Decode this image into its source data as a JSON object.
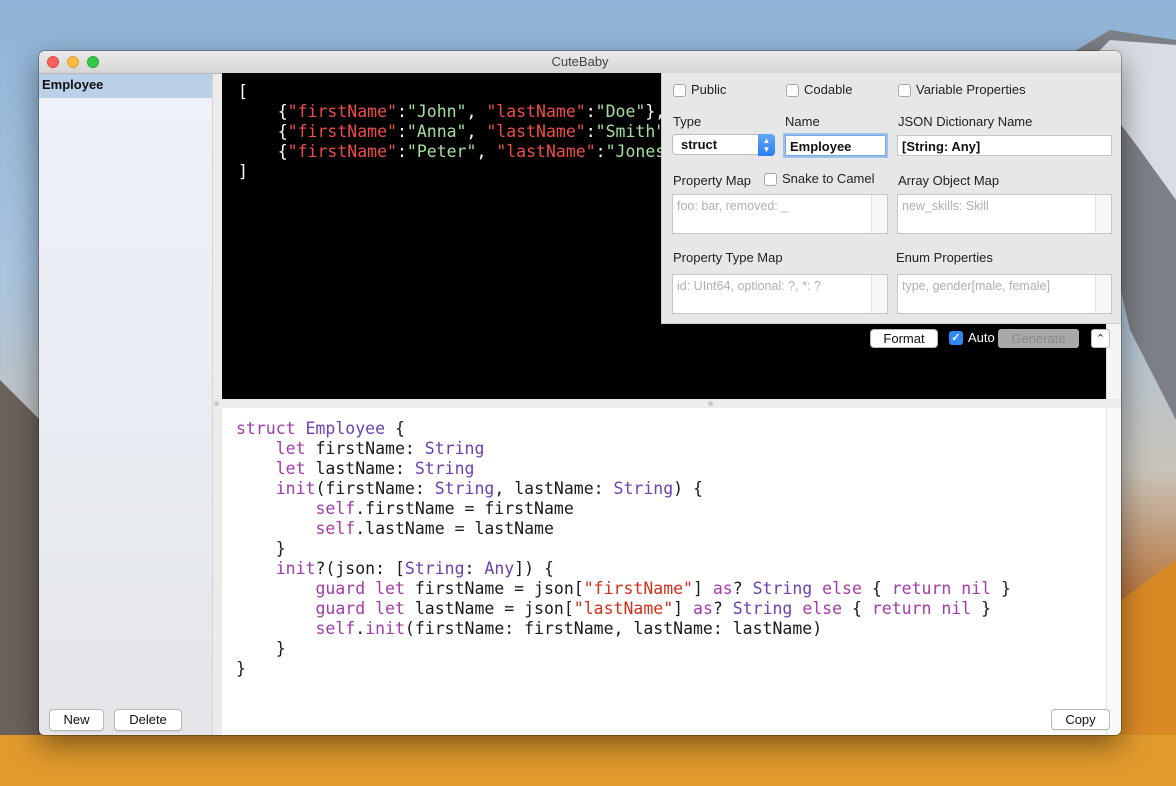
{
  "window": {
    "title": "CuteBaby"
  },
  "sidebar": {
    "items": [
      {
        "label": "Employee",
        "selected": true
      }
    ],
    "new_label": "New",
    "delete_label": "Delete"
  },
  "json_input": {
    "lines": [
      {
        "open": "["
      },
      {
        "k1": "\"firstName\"",
        "v1": "\"John\"",
        "k2": "\"lastName\"",
        "v2": "\"Doe\""
      },
      {
        "k1": "\"firstName\"",
        "v1": "\"Anna\"",
        "k2": "\"lastName\"",
        "v2": "\"Smith\""
      },
      {
        "k1": "\"firstName\"",
        "v1": "\"Peter\"",
        "k2": "\"lastName\"",
        "v2": "\"Jones\""
      },
      {
        "close": "]"
      }
    ]
  },
  "options": {
    "public_label": "Public",
    "codable_label": "Codable",
    "variable_properties_label": "Variable Properties",
    "type_label": "Type",
    "type_value": "struct",
    "name_label": "Name",
    "name_value": "Employee",
    "json_dict_label": "JSON Dictionary Name",
    "json_dict_value": "[String: Any]",
    "property_map_label": "Property Map",
    "snake_to_camel_label": "Snake to Camel",
    "property_map_placeholder": "foo: bar, removed: _",
    "array_object_map_label": "Array Object Map",
    "array_object_map_placeholder": "new_skills: Skill",
    "property_type_map_label": "Property Type Map",
    "property_type_map_placeholder": "id: UInt64, optional: ?, *: ?",
    "enum_properties_label": "Enum Properties",
    "enum_properties_placeholder": "type, gender[male, female]"
  },
  "controls": {
    "format_label": "Format",
    "auto_label": "Auto",
    "auto_checked": true,
    "generate_label": "Generate",
    "collapse_glyph": "⌃"
  },
  "output": {
    "copy_label": "Copy"
  },
  "colors": {
    "accent": "#2d88f3",
    "selection": "#b9d0e8"
  }
}
